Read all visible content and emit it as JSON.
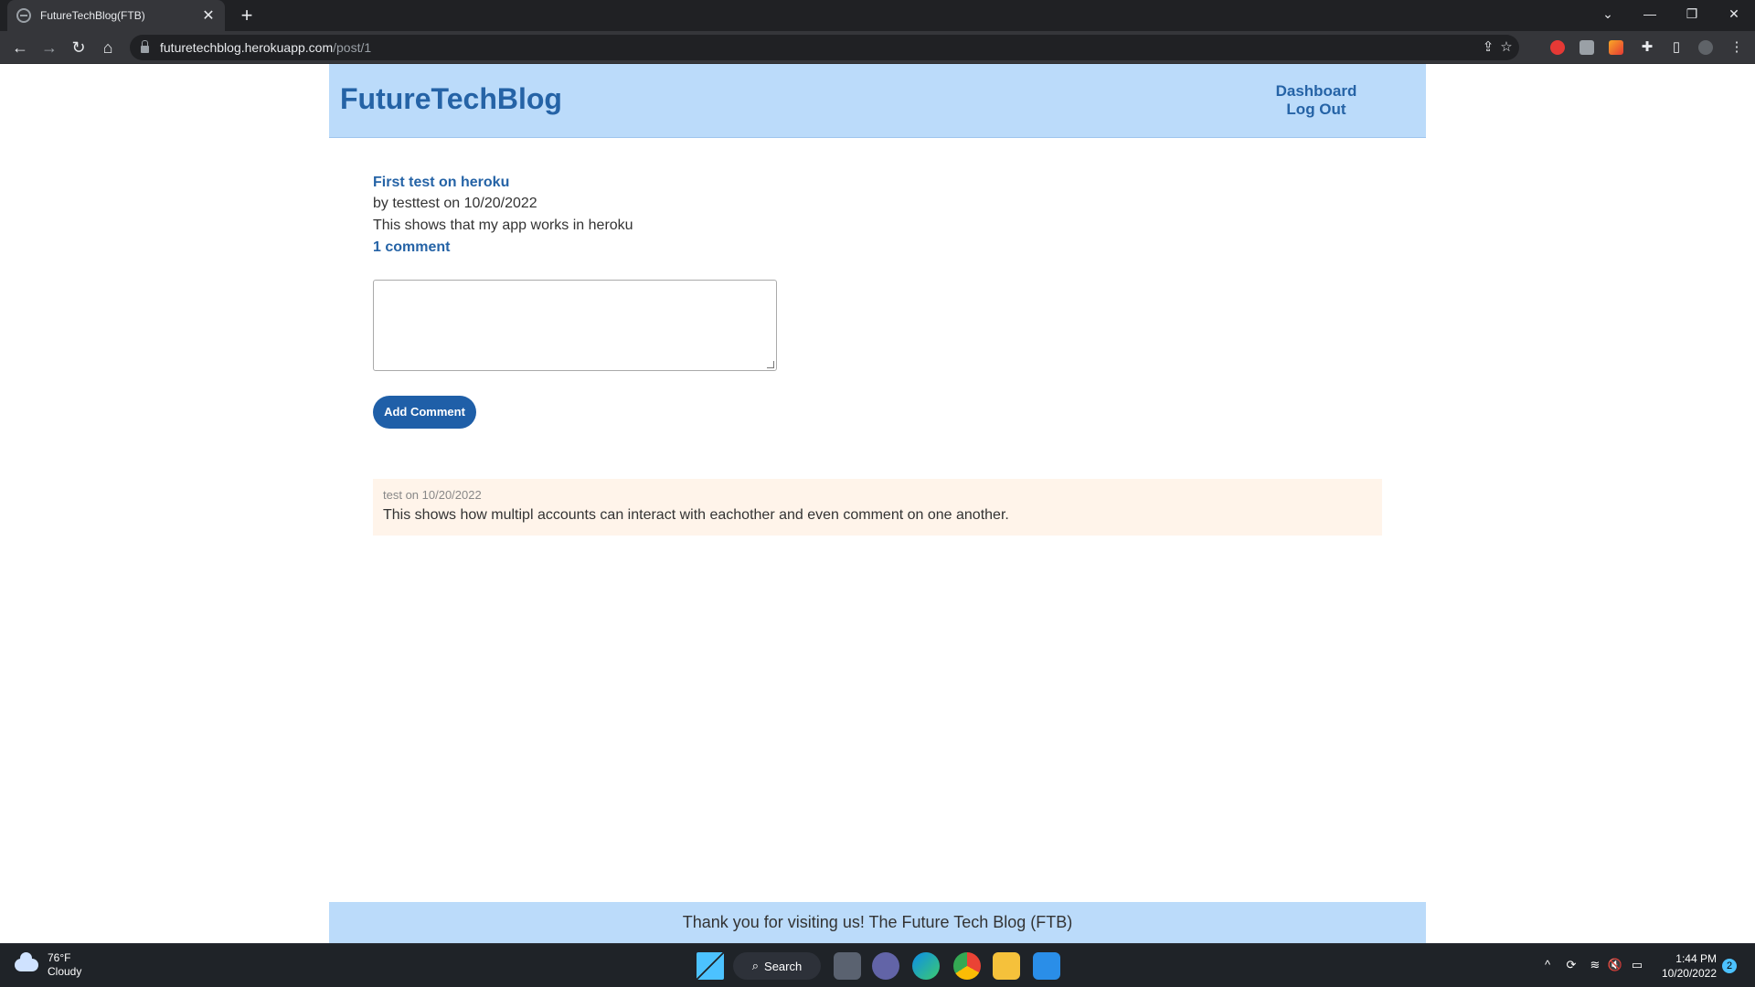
{
  "browser": {
    "tab_title": "FutureTechBlog(FTB)",
    "url_host": "futuretechblog.herokuapp.com",
    "url_path": "/post/1"
  },
  "site": {
    "title": "FutureTechBlog",
    "nav": {
      "dashboard": "Dashboard",
      "logout": "Log Out"
    },
    "footer": "Thank you for visiting us! The Future Tech Blog (FTB)"
  },
  "post": {
    "title": "First test on heroku",
    "meta": "by testtest on 10/20/2022",
    "body": "This shows that my app works in heroku",
    "comments_link": "1 comment"
  },
  "comment_form": {
    "value": "",
    "submit_label": "Add Comment"
  },
  "comments": [
    {
      "meta": "test on 10/20/2022",
      "text": "This shows how multipl accounts can interact with eachother and even comment on one another."
    }
  ],
  "taskbar": {
    "weather_temp": "76°F",
    "weather_desc": "Cloudy",
    "search_label": "Search",
    "time": "1:44 PM",
    "date": "10/20/2022",
    "notifications": "2"
  }
}
